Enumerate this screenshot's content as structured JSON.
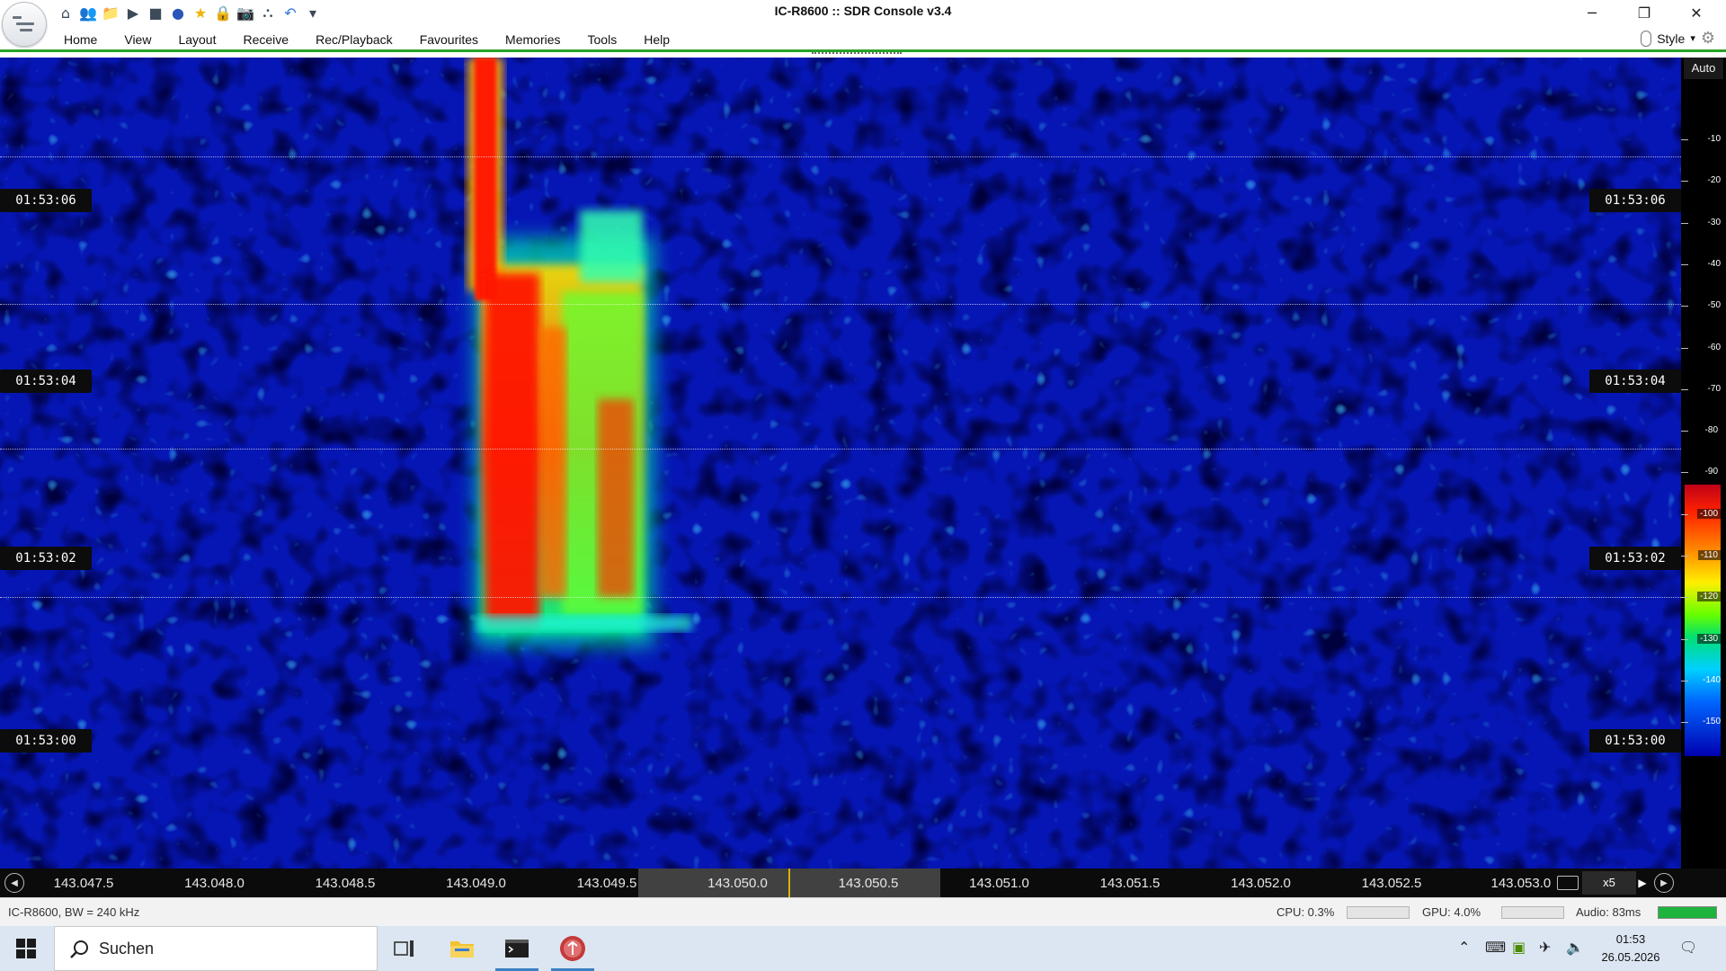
{
  "window": {
    "title": "IC-R8600 :: SDR Console v3.4",
    "minimize": "─",
    "restore": "❐",
    "close": "✕"
  },
  "quick_access": [
    {
      "name": "home-icon",
      "glyph": "⌂"
    },
    {
      "name": "users-icon",
      "glyph": "👥"
    },
    {
      "name": "folder-icon",
      "glyph": "📁"
    },
    {
      "name": "play-icon",
      "glyph": "▶"
    },
    {
      "name": "stop-icon",
      "glyph": "■"
    },
    {
      "name": "radio-icon",
      "glyph": "●"
    },
    {
      "name": "star-icon",
      "glyph": "★"
    },
    {
      "name": "lock-icon",
      "glyph": "🔒"
    },
    {
      "name": "camera-icon",
      "glyph": "📷"
    },
    {
      "name": "antenna-icon",
      "glyph": "⛬"
    },
    {
      "name": "undo-icon",
      "glyph": "↶"
    },
    {
      "name": "customize-qat-icon",
      "glyph": "▾"
    }
  ],
  "menu": [
    "Home",
    "View",
    "Layout",
    "Receive",
    "Rec/Playback",
    "Favourites",
    "Memories",
    "Tools",
    "Help"
  ],
  "style_menu": {
    "label": "Style",
    "arrow": "▾"
  },
  "waterfall": {
    "time_markers": [
      "01:53:06",
      "01:53:04",
      "01:53:02",
      "01:53:00"
    ]
  },
  "level_scale": {
    "auto_label": "Auto",
    "ticks": [
      "-10",
      "-20",
      "-30",
      "-40",
      "-50",
      "-60",
      "-70",
      "-80",
      "-90",
      "-100",
      "-110",
      "-120",
      "-130",
      "-140",
      "-150"
    ]
  },
  "frequency_axis": {
    "labels": [
      "143.047.5",
      "143.048.0",
      "143.048.5",
      "143.049.0",
      "143.049.5",
      "143.050.0",
      "143.050.5",
      "143.051.0",
      "143.051.5",
      "143.052.0",
      "143.052.5",
      "143.053.0"
    ],
    "zoom": "x5",
    "prev_button": "◀",
    "next_button": "▶"
  },
  "status": {
    "device": "IC-R8600, BW = 240 kHz",
    "cpu": "CPU: 0.3%",
    "gpu": "GPU: 4.0%",
    "audio": "Audio: 83ms"
  },
  "taskbar": {
    "search_placeholder": "Suchen",
    "time": "01:53",
    "date": "26.05.2026",
    "tray_icons": [
      "chevron-up-icon",
      "network-icon",
      "nvidia-icon",
      "airplane-mode-icon",
      "volume-icon",
      "notification-icon"
    ]
  },
  "colors": {
    "menu_accent": "#27a327",
    "waterfall_background": "#0a1aa8",
    "signal_core": "#ff1a00",
    "taskbar": "#dce6f2"
  }
}
